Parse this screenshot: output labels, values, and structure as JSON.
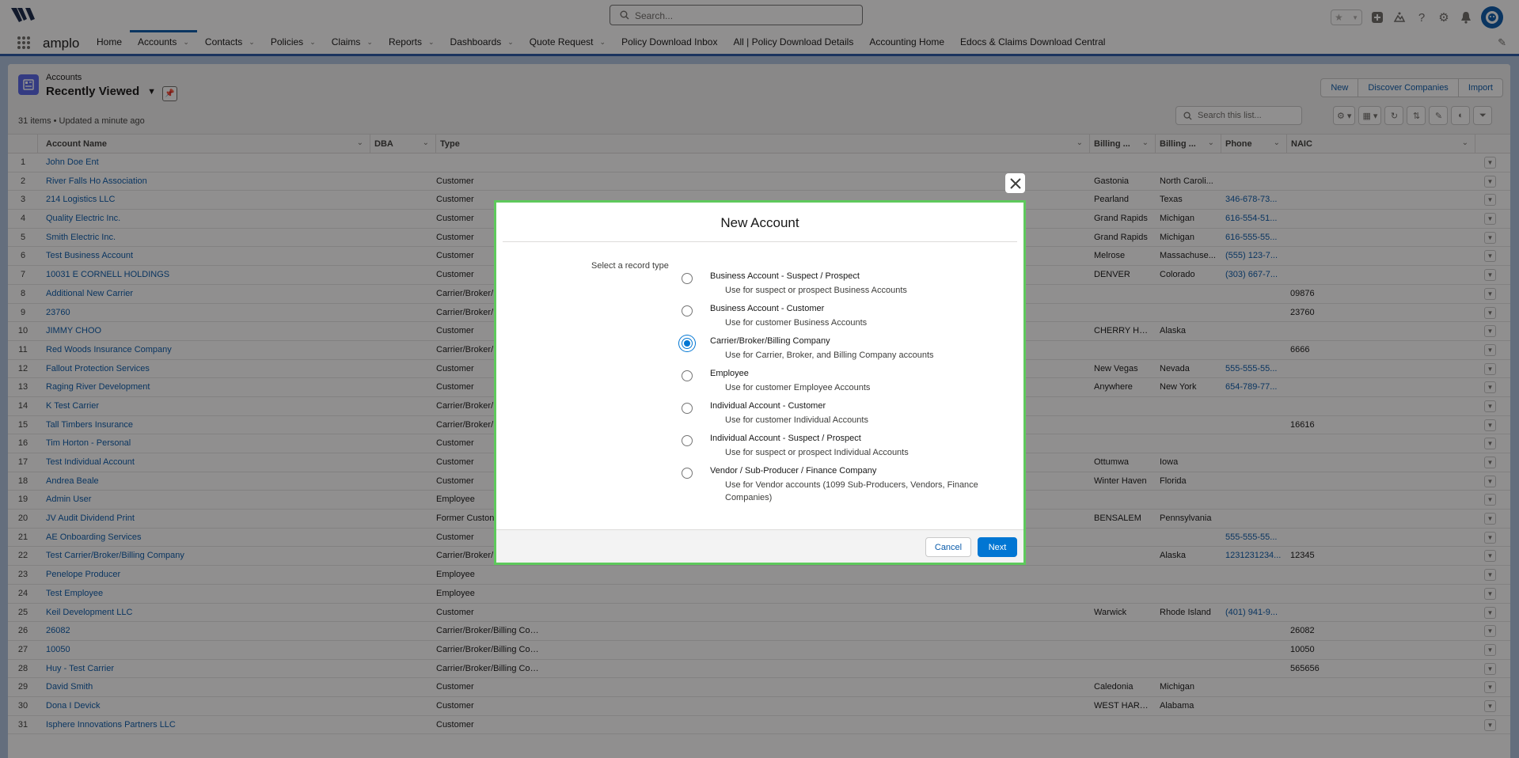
{
  "header": {
    "search_placeholder": "Search...",
    "icons": [
      "favorites-star-icon",
      "global-actions-plus-icon",
      "trailhead-icon",
      "help-icon",
      "setup-gear-icon",
      "notifications-bell-icon"
    ]
  },
  "nav": {
    "app_name": "amplo",
    "items": [
      {
        "label": "Home",
        "has_menu": false
      },
      {
        "label": "Accounts",
        "has_menu": true,
        "active": true
      },
      {
        "label": "Contacts",
        "has_menu": true
      },
      {
        "label": "Policies",
        "has_menu": true
      },
      {
        "label": "Claims",
        "has_menu": true
      },
      {
        "label": "Reports",
        "has_menu": true
      },
      {
        "label": "Dashboards",
        "has_menu": true
      },
      {
        "label": "Quote Request",
        "has_menu": true
      },
      {
        "label": "Policy Download Inbox",
        "has_menu": false
      },
      {
        "label": "All | Policy Download Details",
        "has_menu": false
      },
      {
        "label": "Accounting Home",
        "has_menu": false
      },
      {
        "label": "Edocs & Claims Download Central",
        "has_menu": false
      }
    ]
  },
  "list_view": {
    "object_label": "Accounts",
    "title": "Recently Viewed",
    "meta": "31 items • Updated a minute ago",
    "buttons": {
      "new": "New",
      "discover": "Discover Companies",
      "import": "Import"
    },
    "search_placeholder": "Search this list...",
    "columns": {
      "name": "Account Name",
      "dba": "DBA",
      "type": "Type",
      "billing_city": "Billing ...",
      "billing_state": "Billing ...",
      "phone": "Phone",
      "naic": "NAIC"
    },
    "rows": [
      {
        "n": "1",
        "name": "John Doe Ent",
        "type": "",
        "city": "",
        "state": "",
        "phone": "",
        "naic": ""
      },
      {
        "n": "2",
        "name": "River Falls Ho Association",
        "type": "Customer",
        "city": "Gastonia",
        "state": "North Caroli...",
        "phone": "",
        "naic": ""
      },
      {
        "n": "3",
        "name": "214 Logistics LLC",
        "type": "Customer",
        "city": "Pearland",
        "state": "Texas",
        "phone": "346-678-73...",
        "naic": ""
      },
      {
        "n": "4",
        "name": "Quality Electric Inc.",
        "type": "Customer",
        "city": "Grand Rapids",
        "state": "Michigan",
        "phone": "616-554-51...",
        "naic": ""
      },
      {
        "n": "5",
        "name": "Smith Electric Inc.",
        "type": "Customer",
        "city": "Grand Rapids",
        "state": "Michigan",
        "phone": "616-555-55...",
        "naic": ""
      },
      {
        "n": "6",
        "name": "Test Business Account",
        "type": "Customer",
        "city": "Melrose",
        "state": "Massachuse...",
        "phone": "(555) 123-7...",
        "naic": ""
      },
      {
        "n": "7",
        "name": "10031 E CORNELL HOLDINGS",
        "type": "Customer",
        "city": "DENVER",
        "state": "Colorado",
        "phone": "(303) 667-7...",
        "naic": ""
      },
      {
        "n": "8",
        "name": "Additional New Carrier",
        "type": "Carrier/Broker/",
        "city": "",
        "state": "",
        "phone": "",
        "naic": "09876"
      },
      {
        "n": "9",
        "name": "23760",
        "type": "Carrier/Broker/",
        "city": "",
        "state": "",
        "phone": "",
        "naic": "23760"
      },
      {
        "n": "10",
        "name": "JIMMY CHOO",
        "type": "Customer",
        "city": "CHERRY HILL",
        "state": "Alaska",
        "phone": "",
        "naic": ""
      },
      {
        "n": "11",
        "name": "Red Woods Insurance Company",
        "type": "Carrier/Broker/",
        "city": "",
        "state": "",
        "phone": "",
        "naic": "6666"
      },
      {
        "n": "12",
        "name": "Fallout Protection Services",
        "type": "Customer",
        "city": "New Vegas",
        "state": "Nevada",
        "phone": "555-555-55...",
        "naic": ""
      },
      {
        "n": "13",
        "name": "Raging River Development",
        "type": "Customer",
        "city": "Anywhere",
        "state": "New York",
        "phone": "654-789-77...",
        "naic": ""
      },
      {
        "n": "14",
        "name": "K Test Carrier",
        "type": "Carrier/Broker/",
        "city": "",
        "state": "",
        "phone": "",
        "naic": ""
      },
      {
        "n": "15",
        "name": "Tall Timbers Insurance",
        "type": "Carrier/Broker/",
        "city": "",
        "state": "",
        "phone": "",
        "naic": "16616"
      },
      {
        "n": "16",
        "name": "Tim Horton - Personal",
        "type": "Customer",
        "city": "",
        "state": "",
        "phone": "",
        "naic": ""
      },
      {
        "n": "17",
        "name": "Test Individual Account",
        "type": "Customer",
        "city": "Ottumwa",
        "state": "Iowa",
        "phone": "",
        "naic": ""
      },
      {
        "n": "18",
        "name": "Andrea Beale",
        "type": "Customer",
        "city": "Winter Haven",
        "state": "Florida",
        "phone": "",
        "naic": ""
      },
      {
        "n": "19",
        "name": "Admin User",
        "type": "Employee",
        "city": "",
        "state": "",
        "phone": "",
        "naic": ""
      },
      {
        "n": "20",
        "name": "JV Audit Dividend Print",
        "type": "Former Custon",
        "city": "BENSALEM",
        "state": "Pennsylvania",
        "phone": "",
        "naic": ""
      },
      {
        "n": "21",
        "name": "AE Onboarding Services",
        "type": "Customer",
        "city": "",
        "state": "",
        "phone": "555-555-55...",
        "naic": ""
      },
      {
        "n": "22",
        "name": "Test Carrier/Broker/Billing Company",
        "type": "Carrier/Broker/",
        "city": "",
        "state": "Alaska",
        "phone": "1231231234...",
        "naic": "12345"
      },
      {
        "n": "23",
        "name": "Penelope Producer",
        "type": "Employee",
        "city": "",
        "state": "",
        "phone": "",
        "naic": ""
      },
      {
        "n": "24",
        "name": "Test Employee",
        "type": "Employee",
        "city": "",
        "state": "",
        "phone": "",
        "naic": ""
      },
      {
        "n": "25",
        "name": "Keil Development LLC",
        "type": "Customer",
        "city": "Warwick",
        "state": "Rhode Island",
        "phone": "(401) 941-9...",
        "naic": ""
      },
      {
        "n": "26",
        "name": "26082",
        "type": "Carrier/Broker/Billing Company",
        "city": "",
        "state": "",
        "phone": "",
        "naic": "26082"
      },
      {
        "n": "27",
        "name": "10050",
        "type": "Carrier/Broker/Billing Company",
        "city": "",
        "state": "",
        "phone": "",
        "naic": "10050"
      },
      {
        "n": "28",
        "name": "Huy - Test Carrier",
        "type": "Carrier/Broker/Billing Company",
        "city": "",
        "state": "",
        "phone": "",
        "naic": "565656"
      },
      {
        "n": "29",
        "name": "David Smith",
        "type": "Customer",
        "city": "Caledonia",
        "state": "Michigan",
        "phone": "",
        "naic": ""
      },
      {
        "n": "30",
        "name": "Dona I Devick",
        "type": "Customer",
        "city": "WEST HART...",
        "state": "Alabama",
        "phone": "",
        "naic": ""
      },
      {
        "n": "31",
        "name": "Isphere Innovations Partners LLC",
        "type": "Customer",
        "city": "",
        "state": "",
        "phone": "",
        "naic": ""
      }
    ]
  },
  "modal": {
    "title": "New Account",
    "record_type_label": "Select a record type",
    "options": [
      {
        "title": "Business Account - Suspect / Prospect",
        "description": "Use for suspect or prospect Business Accounts",
        "checked": false
      },
      {
        "title": "Business Account - Customer",
        "description": "Use for customer Business Accounts",
        "checked": false
      },
      {
        "title": "Carrier/Broker/Billing Company",
        "description": "Use for Carrier, Broker, and Billing Company accounts",
        "checked": true
      },
      {
        "title": "Employee",
        "description": "Use for customer Employee Accounts",
        "checked": false
      },
      {
        "title": "Individual Account - Customer",
        "description": "Use for customer Individual Accounts",
        "checked": false
      },
      {
        "title": "Individual Account - Suspect / Prospect",
        "description": "Use for suspect or prospect Individual Accounts",
        "checked": false
      },
      {
        "title": "Vendor / Sub-Producer / Finance Company",
        "description": "Use for Vendor accounts (1099 Sub-Producers, Vendors, Finance Companies)",
        "checked": false
      }
    ],
    "cancel_label": "Cancel",
    "next_label": "Next"
  },
  "colors": {
    "brand_blue": "#0176d3",
    "link_blue": "#0b5cab",
    "nav_accent": "#2a5aa8",
    "modal_highlight": "#5ec95c",
    "object_icon": "#5867e8"
  }
}
